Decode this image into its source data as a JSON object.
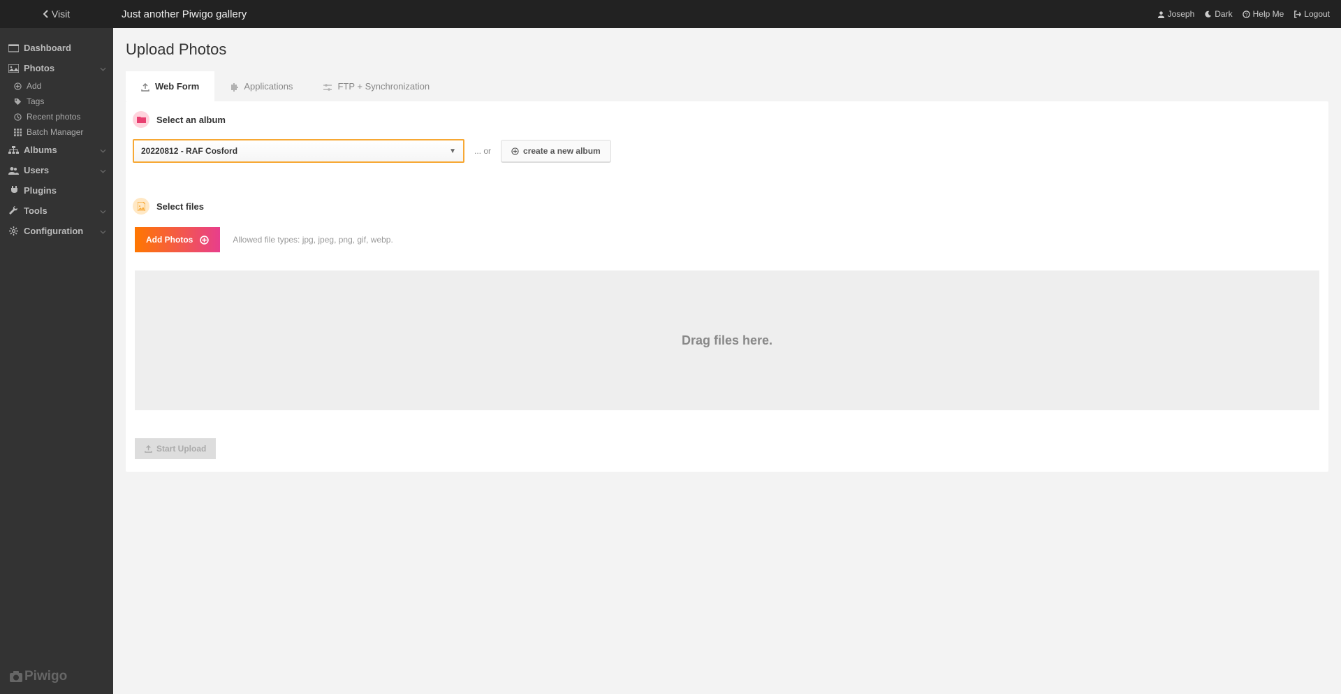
{
  "topbar": {
    "visit": "Visit",
    "title": "Just another Piwigo gallery",
    "right": [
      {
        "icon": "user",
        "label": "Joseph"
      },
      {
        "icon": "moon",
        "label": "Dark"
      },
      {
        "icon": "help",
        "label": "Help Me"
      },
      {
        "icon": "logout",
        "label": "Logout"
      }
    ]
  },
  "sidebar": {
    "items": [
      {
        "icon": "dashboard",
        "label": "Dashboard",
        "expandable": false
      },
      {
        "icon": "image",
        "label": "Photos",
        "expandable": true,
        "expanded": true
      },
      {
        "icon": "sitemap",
        "label": "Albums",
        "expandable": true
      },
      {
        "icon": "users",
        "label": "Users",
        "expandable": true
      },
      {
        "icon": "plug",
        "label": "Plugins",
        "expandable": false
      },
      {
        "icon": "wrench",
        "label": "Tools",
        "expandable": true
      },
      {
        "icon": "cog",
        "label": "Configuration",
        "expandable": true
      }
    ],
    "photos_sub": [
      {
        "icon": "plus-circle",
        "label": "Add"
      },
      {
        "icon": "tag",
        "label": "Tags"
      },
      {
        "icon": "clock",
        "label": "Recent photos"
      },
      {
        "icon": "grid",
        "label": "Batch Manager"
      }
    ],
    "brand": "Piwigo"
  },
  "page": {
    "title": "Upload Photos"
  },
  "tabs": [
    {
      "id": "webform",
      "icon": "upload",
      "label": "Web Form"
    },
    {
      "id": "apps",
      "icon": "puzzle",
      "label": "Applications"
    },
    {
      "id": "ftp",
      "icon": "sliders",
      "label": "FTP + Synchronization"
    }
  ],
  "album": {
    "title": "Select an album",
    "selected": "20220812 - RAF Cosford",
    "or": "... or",
    "new_button": "create a new album"
  },
  "files": {
    "title": "Select files",
    "add_btn": "Add Photos",
    "hint": "Allowed file types: jpg, jpeg, png, gif, webp.",
    "drop_label": "Drag files here."
  },
  "start": {
    "label": "Start Upload"
  }
}
